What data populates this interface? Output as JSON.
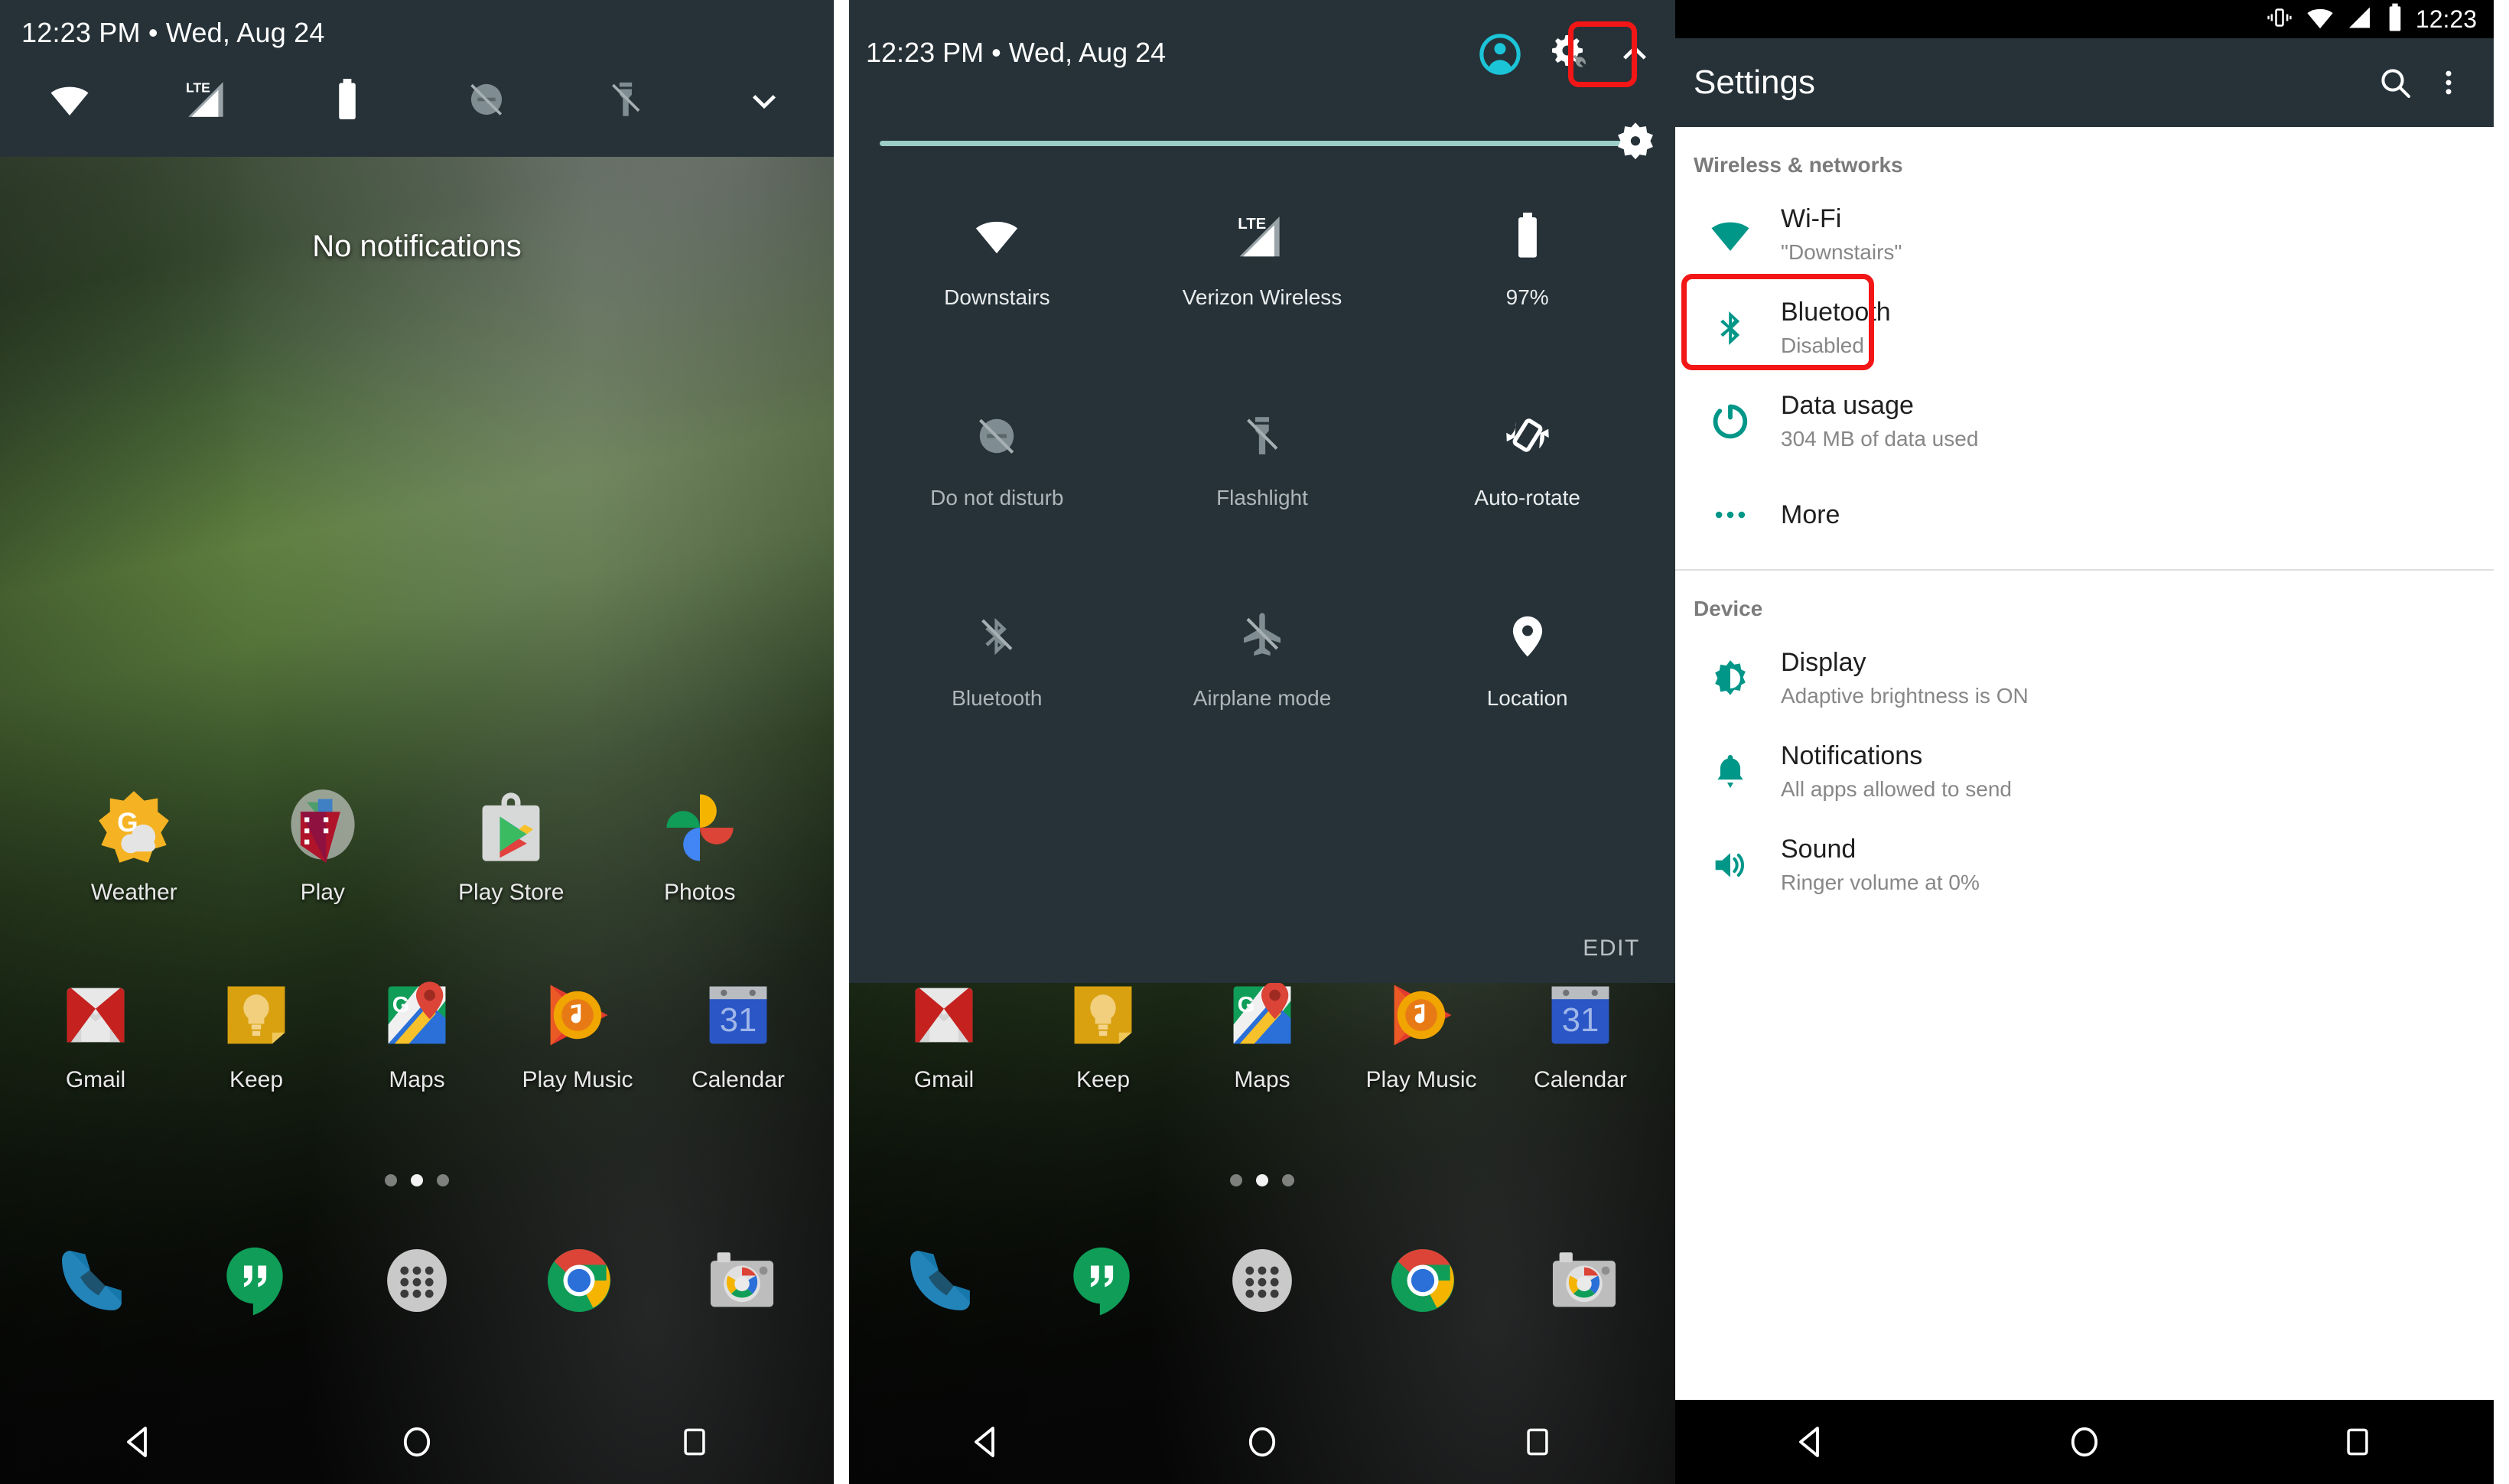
{
  "accent": {
    "teal": "#009688",
    "panel_bg": "#263238",
    "highlight_red": "#f31616",
    "slider_teal": "#9ccfc9"
  },
  "panel_home": {
    "name": "android-home-with-collapsed-shade",
    "status": {
      "clock": "12:23 PM  •  Wed, Aug 24",
      "icons": [
        "wifi-icon",
        "lte-signal-icon",
        "battery-icon",
        "do-not-disturb-off-icon",
        "flashlight-off-icon",
        "chevron-down-icon"
      ]
    },
    "notifications_empty_text": "No notifications",
    "apps_row1": [
      {
        "label": "Weather",
        "icon": "google-weather-icon"
      },
      {
        "label": "Play",
        "icon": "google-play-movies-icon"
      },
      {
        "label": "Play Store",
        "icon": "google-play-store-icon"
      },
      {
        "label": "Photos",
        "icon": "google-photos-icon"
      }
    ],
    "apps_row2": [
      {
        "label": "Gmail",
        "icon": "gmail-icon"
      },
      {
        "label": "Keep",
        "icon": "google-keep-icon"
      },
      {
        "label": "Maps",
        "icon": "google-maps-icon"
      },
      {
        "label": "Play Music",
        "icon": "google-play-music-icon"
      },
      {
        "label": "Calendar",
        "icon": "google-calendar-icon"
      }
    ],
    "page_dots": {
      "count": 3,
      "active_index": 1
    },
    "dock": [
      {
        "label": "Phone",
        "icon": "phone-icon"
      },
      {
        "label": "Hangouts",
        "icon": "hangouts-icon"
      },
      {
        "label": "All apps",
        "icon": "all-apps-icon"
      },
      {
        "label": "Chrome",
        "icon": "chrome-icon"
      },
      {
        "label": "Camera",
        "icon": "camera-icon"
      }
    ],
    "navbar": [
      "back-icon",
      "home-icon",
      "recents-icon"
    ]
  },
  "panel_quicksettings": {
    "name": "android-quick-settings-expanded",
    "clock": "12:23 PM  •  Wed, Aug 24",
    "actions": [
      {
        "name": "user-avatar-icon",
        "label": "User"
      },
      {
        "name": "settings-tuner-gear-icon",
        "label": "Settings",
        "highlighted": true
      },
      {
        "name": "chevron-up-icon",
        "label": "Collapse"
      }
    ],
    "brightness": {
      "name": "brightness-slider",
      "value_percent": 97
    },
    "tiles": [
      {
        "label": "Downstairs",
        "icon": "wifi-icon",
        "state": "on"
      },
      {
        "label": "Verizon Wireless",
        "icon": "lte-signal-icon",
        "state": "on"
      },
      {
        "label": "97%",
        "icon": "battery-icon",
        "state": "on"
      },
      {
        "label": "Do not disturb",
        "icon": "do-not-disturb-off-icon",
        "state": "off"
      },
      {
        "label": "Flashlight",
        "icon": "flashlight-off-icon",
        "state": "off"
      },
      {
        "label": "Auto-rotate",
        "icon": "auto-rotate-icon",
        "state": "on"
      },
      {
        "label": "Bluetooth",
        "icon": "bluetooth-off-icon",
        "state": "off"
      },
      {
        "label": "Airplane mode",
        "icon": "airplane-off-icon",
        "state": "off"
      },
      {
        "label": "Location",
        "icon": "location-pin-icon",
        "state": "on"
      }
    ],
    "edit_label": "EDIT",
    "navbar": [
      "back-icon",
      "home-icon",
      "recents-icon"
    ]
  },
  "panel_settings": {
    "name": "android-settings-app",
    "statusbar": {
      "icons": [
        "vibrate-icon",
        "wifi-icon",
        "signal-icon",
        "battery-icon"
      ],
      "time": "12:23"
    },
    "appbar": {
      "title": "Settings",
      "search_icon": "search-icon",
      "overflow_icon": "overflow-menu-icon"
    },
    "sections": [
      {
        "header": "Wireless & networks",
        "items": [
          {
            "title": "Wi-Fi",
            "subtitle": "\"Downstairs\"",
            "icon": "wifi-icon",
            "highlighted": false
          },
          {
            "title": "Bluetooth",
            "subtitle": "Disabled",
            "icon": "bluetooth-icon",
            "highlighted": true
          },
          {
            "title": "Data usage",
            "subtitle": "304 MB of data used",
            "icon": "data-usage-icon",
            "highlighted": false
          },
          {
            "title": "More",
            "subtitle": "",
            "icon": "more-dots-icon",
            "highlighted": false
          }
        ]
      },
      {
        "header": "Device",
        "items": [
          {
            "title": "Display",
            "subtitle": "Adaptive brightness is ON",
            "icon": "display-brightness-icon",
            "highlighted": false
          },
          {
            "title": "Notifications",
            "subtitle": "All apps allowed to send",
            "icon": "bell-icon",
            "highlighted": false
          },
          {
            "title": "Sound",
            "subtitle": "Ringer volume at 0%",
            "icon": "volume-icon",
            "highlighted": false
          }
        ]
      }
    ],
    "navbar": [
      "back-icon",
      "home-icon",
      "recents-icon"
    ]
  }
}
